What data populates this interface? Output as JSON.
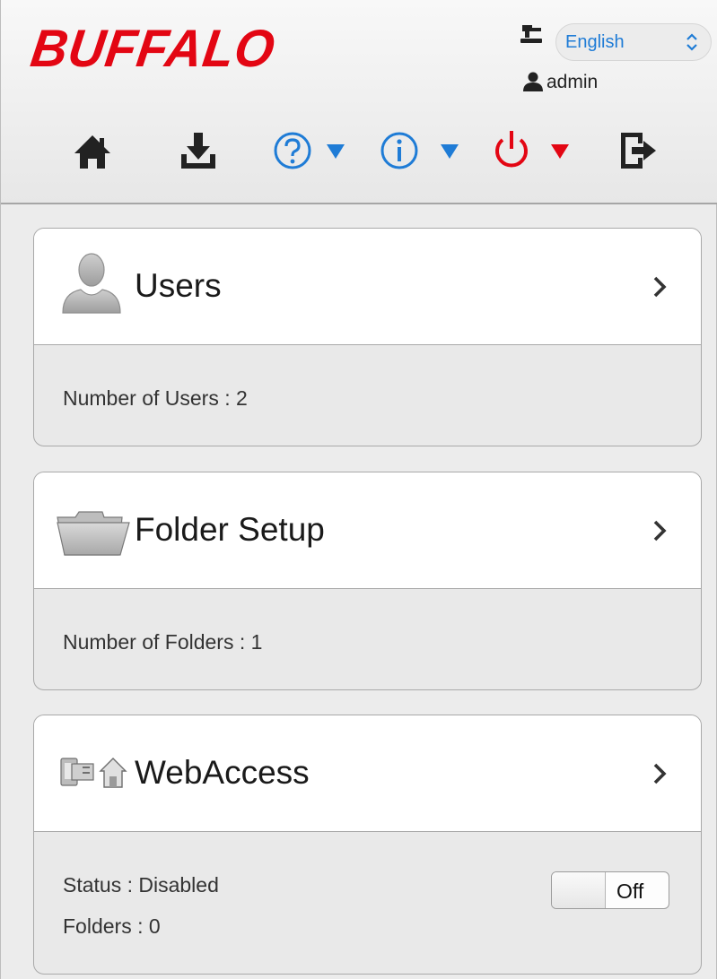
{
  "header": {
    "logo_text": "BUFFALO",
    "language": {
      "selected": "English"
    },
    "user": {
      "name": "admin"
    },
    "toolbar": {
      "icons": [
        "home-icon",
        "download-icon",
        "help-icon",
        "info-icon",
        "power-icon",
        "logout-icon"
      ],
      "colors": {
        "dark": "#222222",
        "blue": "#1f7cd6",
        "red": "#e30613"
      }
    }
  },
  "cards": [
    {
      "title": "Users",
      "icon": "user-silhouette-icon",
      "lines": [
        "Number of Users : 2"
      ]
    },
    {
      "title": "Folder Setup",
      "icon": "folder-icon",
      "lines": [
        "Number of Folders : 1"
      ]
    },
    {
      "title": "WebAccess",
      "icon": "webaccess-icon",
      "lines": [
        "Status : Disabled",
        "Folders : 0"
      ],
      "toggle": {
        "label": "Off",
        "state": "off"
      }
    }
  ]
}
